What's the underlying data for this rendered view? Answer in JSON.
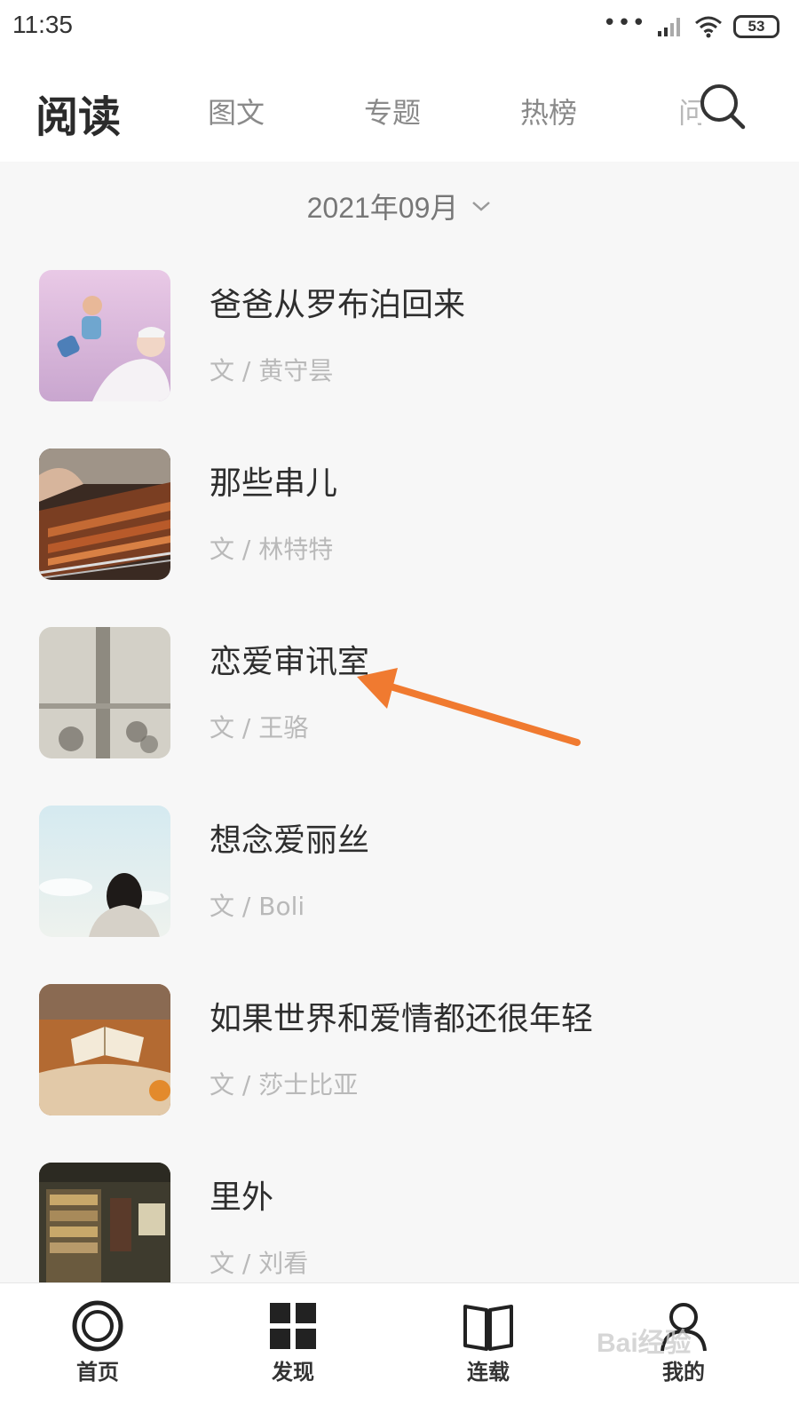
{
  "status_bar": {
    "time": "11:35",
    "battery": "53",
    "icons": [
      "signal-dots-icon",
      "cell-signal-icon",
      "wifi-icon",
      "battery-icon"
    ]
  },
  "header": {
    "title": "阅读",
    "tabs": [
      {
        "label": "图文"
      },
      {
        "label": "专题"
      },
      {
        "label": "热榜"
      },
      {
        "label": "问"
      }
    ],
    "search_icon": "search-icon"
  },
  "date_selector": {
    "label": "2021年09月",
    "icon": "chevron-down-icon"
  },
  "articles": [
    {
      "title": "爸爸从罗布泊回来",
      "author": "文 / 黄守昙"
    },
    {
      "title": "那些串儿",
      "author": "文 / 林特特"
    },
    {
      "title": "恋爱审讯室",
      "author": "文 / 王骆"
    },
    {
      "title": "想念爱丽丝",
      "author": "文 / Boli"
    },
    {
      "title": "如果世界和爱情都还很年轻",
      "author": "文 / 莎士比亚"
    },
    {
      "title": "里外",
      "author": "文 / 刘看"
    }
  ],
  "bottom_nav": [
    {
      "label": "首页",
      "icon": "home-circle-icon"
    },
    {
      "label": "发现",
      "icon": "grid-icon"
    },
    {
      "label": "连载",
      "icon": "book-icon"
    },
    {
      "label": "我的",
      "icon": "user-icon"
    }
  ],
  "annotation": {
    "color": "#f07a30"
  },
  "watermark": {
    "text": "Bai经验"
  },
  "colors": {
    "accent_arrow": "#f07a30",
    "background": "#f7f7f7",
    "header": "#ffffff"
  }
}
